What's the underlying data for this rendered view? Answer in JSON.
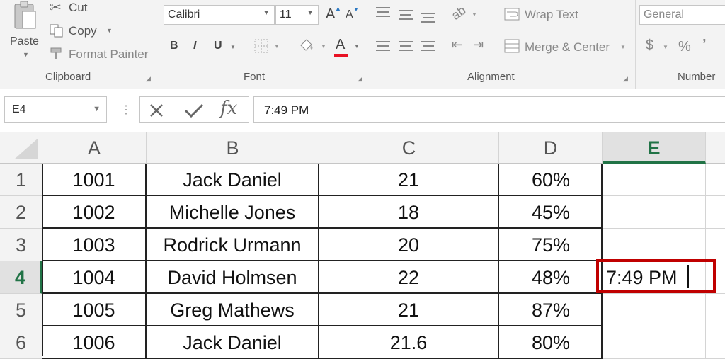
{
  "ribbon": {
    "clipboard": {
      "paste_label": "Paste",
      "cut_label": "Cut",
      "copy_label": "Copy",
      "format_painter_label": "Format Painter",
      "group_label": "Clipboard"
    },
    "font": {
      "font_name": "Calibri",
      "font_size": "11",
      "bold_label": "B",
      "italic_label": "I",
      "underline_label": "U",
      "grow_label": "A",
      "shrink_label": "A",
      "font_color_label": "A",
      "font_color": "#e81123",
      "group_label": "Font"
    },
    "alignment": {
      "wrap_text_label": "Wrap Text",
      "merge_center_label": "Merge & Center",
      "group_label": "Alignment"
    },
    "number": {
      "format_value": "General",
      "currency_label": "$",
      "percent_label": "%",
      "comma_label": "’",
      "group_label": "Number"
    }
  },
  "formula_bar": {
    "name_box": "E4",
    "formula": "7:49 PM"
  },
  "grid": {
    "columns": [
      "A",
      "B",
      "C",
      "D",
      "E"
    ],
    "selected_column": "E",
    "rows": [
      {
        "num": "1",
        "cells": [
          "1001",
          "Jack Daniel",
          "21",
          "60%",
          ""
        ]
      },
      {
        "num": "2",
        "cells": [
          "1002",
          "Michelle Jones",
          "18",
          "45%",
          ""
        ]
      },
      {
        "num": "3",
        "cells": [
          "1003",
          "Rodrick Urmann",
          "20",
          "75%",
          ""
        ]
      },
      {
        "num": "4",
        "cells": [
          "1004",
          "David Holmsen",
          "22",
          "48%",
          "7:49 PM"
        ]
      },
      {
        "num": "5",
        "cells": [
          "1005",
          "Greg Mathews",
          "21",
          "87%",
          ""
        ]
      },
      {
        "num": "6",
        "cells": [
          "1006",
          "Jack Daniel",
          "21.6",
          "80%",
          ""
        ]
      }
    ],
    "selected_row": "4",
    "active_cell_color": "#c00000",
    "accent_color": "#217346"
  }
}
